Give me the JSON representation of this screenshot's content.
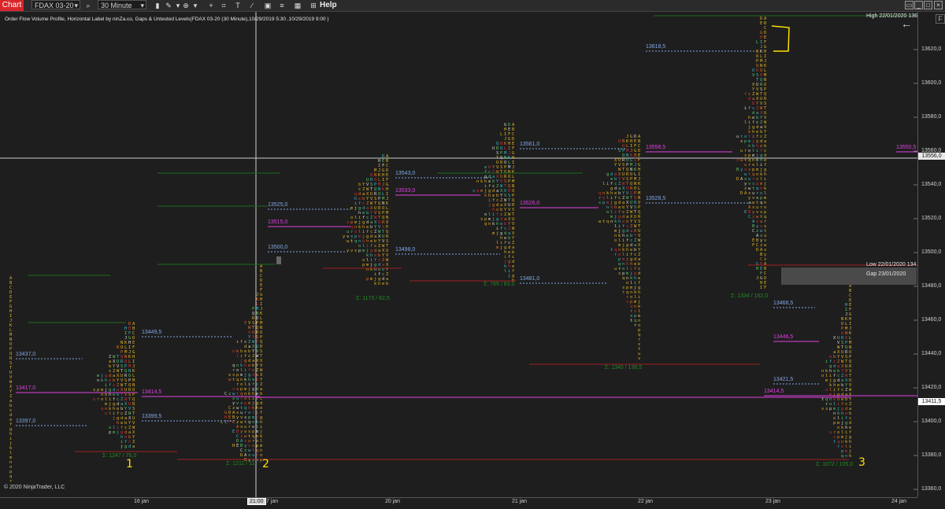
{
  "toolbar": {
    "tab_label": "Chart",
    "instrument": "FDAX 03-20",
    "interval": "30 Minute",
    "help_label": "Help",
    "icons": [
      "bar-chart-icon",
      "draw-icon",
      "draw-menu-icon",
      "zoom-icon",
      "crosshair-icon",
      "text-icon",
      "drawing-tools-icon",
      "strategy-icon",
      "properties-icon",
      "list-icon",
      "indicator-icon"
    ],
    "window_buttons": [
      "restore-icon",
      "minimize-icon",
      "maximize-icon",
      "close-icon"
    ]
  },
  "indicator_label": "Order Flow Volume Profile, Horizontal Label by ninZa.co, Gaps & Untested Levels(FDAX 03-20 (30 Minute),10/29/2019 5:30 ,10/29/2019 9:00 )",
  "copyright": "© 2020 NinjaTrader, LLC",
  "price_axis": {
    "ticks": [
      "13620,0",
      "13600,0",
      "13580,0",
      "13560,0",
      "13540,0",
      "13520,0",
      "13500,0",
      "13480,0",
      "13460,0",
      "13440,0",
      "13420,0",
      "13400,0",
      "13380,0",
      "13360,0"
    ],
    "current_price": "13556,0",
    "last_price": "13411,5"
  },
  "time_axis": {
    "ticks": [
      "16 jan",
      "20 jan",
      "21 jan",
      "22 jan",
      "23 jan",
      "24 jan"
    ],
    "cursor_label": "21:00",
    "cursor_suffix": "7 jan"
  },
  "annotations": {
    "high": "High 22/01/2020  136",
    "low": "Low 22/01/2020  134",
    "gap": "Gap 23/01/2020"
  },
  "levels": [
    {
      "text": "13437,0",
      "color": "#7fa8e6"
    },
    {
      "text": "13417,0",
      "color": "#e040e0"
    },
    {
      "text": "13397,0",
      "color": "#7fa8e6"
    },
    {
      "text": "13449,5",
      "color": "#7fa8e6"
    },
    {
      "text": "13414,5",
      "color": "#e040e0"
    },
    {
      "text": "13399,5",
      "color": "#7fa8e6"
    },
    {
      "text": "13525,0",
      "color": "#7fa8e6"
    },
    {
      "text": "13515,0",
      "color": "#e040e0"
    },
    {
      "text": "13500,0",
      "color": "#7fa8e6"
    },
    {
      "text": "13543,0",
      "color": "#7fa8e6"
    },
    {
      "text": "13533,0",
      "color": "#e040e0"
    },
    {
      "text": "13498,0",
      "color": "#7fa8e6"
    },
    {
      "text": "13561,0",
      "color": "#7fa8e6"
    },
    {
      "text": "13526,0",
      "color": "#e040e0"
    },
    {
      "text": "13481,0",
      "color": "#7fa8e6"
    },
    {
      "text": "13618,5",
      "color": "#7fa8e6"
    },
    {
      "text": "13558,5",
      "color": "#e040e0"
    },
    {
      "text": "13528,5",
      "color": "#7fa8e6"
    },
    {
      "text": "13550,5",
      "color": "#e040e0"
    },
    {
      "text": "13466,5",
      "color": "#7fa8e6"
    },
    {
      "text": "13446,5",
      "color": "#e040e0"
    },
    {
      "text": "13421,5",
      "color": "#7fa8e6"
    },
    {
      "text": "13414,5",
      "color": "#e040e0"
    }
  ],
  "profile_stats": [
    "Σ: 1247 / 76,0",
    "Σ: 1211 / 11",
    "Σ: 1173 / 82,5",
    "Σ: 765 / 83,0",
    "Σ: 1340 / 136,5",
    "Σ: 1334 / 162,0",
    "Σ: 1072 / 105,0"
  ],
  "handwritten_numbers": [
    "1",
    "2",
    "3"
  ],
  "colors": {
    "background": "#1e1e1e",
    "poc": "#e040e0",
    "va": "#7fa8e6",
    "stat": "#1f8c1f",
    "tpo_yellow": "#e0b020",
    "tpo_orange": "#e07020",
    "tpo_red": "#d03030",
    "tpo_cyan": "#30b8c8",
    "tpo_green": "#60c060",
    "tpo_white": "#d0d0d0"
  }
}
